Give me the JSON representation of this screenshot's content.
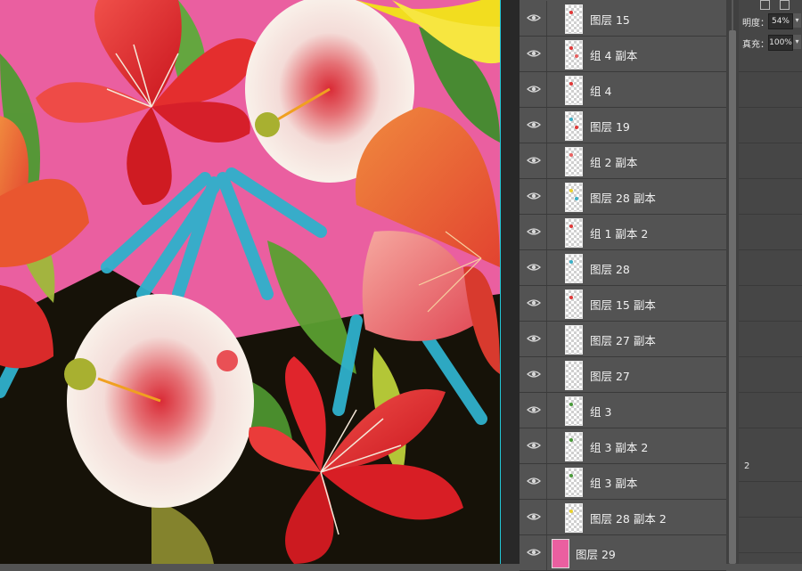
{
  "layers": [
    {
      "name": "图层 15",
      "visible": true,
      "thumb_colors": [
        "#e03838"
      ]
    },
    {
      "name": "组 4 副本",
      "visible": true,
      "thumb_colors": [
        "#e03838",
        "#e86060"
      ]
    },
    {
      "name": "组 4",
      "visible": true,
      "thumb_colors": [
        "#e03838"
      ]
    },
    {
      "name": "图层 19",
      "visible": true,
      "thumb_colors": [
        "#3bb0c7",
        "#e03838"
      ]
    },
    {
      "name": "组 2 副本",
      "visible": true,
      "thumb_colors": [
        "#e86060"
      ]
    },
    {
      "name": "图层 28 副本",
      "visible": true,
      "thumb_colors": [
        "#e8d030",
        "#3bb0c7"
      ]
    },
    {
      "name": "组 1 副本 2",
      "visible": true,
      "thumb_colors": [
        "#e03838"
      ]
    },
    {
      "name": "图层 28",
      "visible": true,
      "thumb_colors": [
        "#3bb0c7"
      ]
    },
    {
      "name": "图层 15 副本",
      "visible": true,
      "thumb_colors": [
        "#e03838"
      ]
    },
    {
      "name": "图层 27 副本",
      "visible": true,
      "thumb_colors": []
    },
    {
      "name": "图层 27",
      "visible": true,
      "thumb_colors": []
    },
    {
      "name": "组 3",
      "visible": true,
      "thumb_colors": [
        "#4a9a3a"
      ]
    },
    {
      "name": "组 3 副本 2",
      "visible": true,
      "thumb_colors": [
        "#4a9a3a"
      ]
    },
    {
      "name": "组 3 副本",
      "visible": true,
      "thumb_colors": [
        "#4a9a3a"
      ]
    },
    {
      "name": "图层 28 副本 2",
      "visible": true,
      "thumb_colors": [
        "#e8d030"
      ]
    },
    {
      "name": "图层 29",
      "visible": true,
      "thumb_colors": [
        "#ea5fa0"
      ],
      "solid": true
    }
  ],
  "properties": {
    "opacity_label": "明度：",
    "opacity_value": "54%",
    "fill_label": "真充：",
    "fill_value": "100%",
    "side_number": "2"
  },
  "colors": {
    "canvas_pink": "#ea5fa0",
    "canvas_dark": "#161208",
    "panel_bg": "#535353",
    "guide": "#22c6d6"
  }
}
